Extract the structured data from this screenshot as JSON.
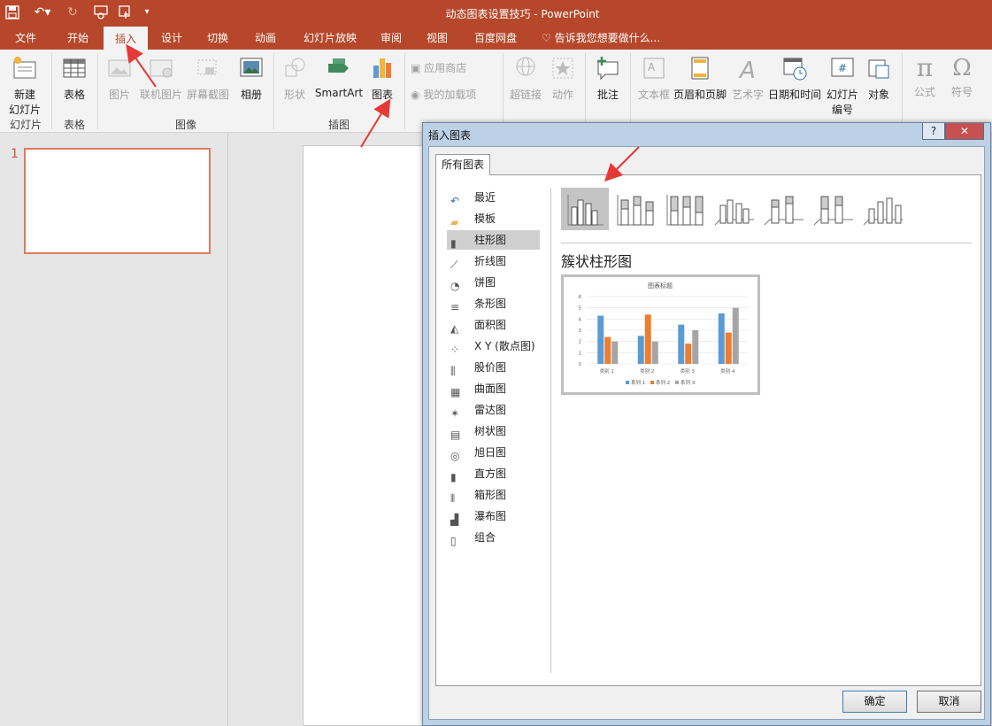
{
  "titlebar": {
    "title": "动态图表设置技巧 - PowerPoint",
    "quick_access": [
      "save-icon",
      "undo-icon",
      "redo-icon",
      "present-icon",
      "touch-mode-icon",
      "customize-icon"
    ]
  },
  "tabs": [
    "文件",
    "开始",
    "插入",
    "设计",
    "切换",
    "动画",
    "幻灯片放映",
    "审阅",
    "视图",
    "百度网盘"
  ],
  "active_tab": "插入",
  "tell_me": "告诉我您想要做什么...",
  "ribbon": {
    "new_slide": "新建\n幻灯片",
    "new_slide_line1": "新建",
    "new_slide_line2": "幻灯片",
    "table": "表格",
    "picture": "图片",
    "online_picture": "联机图片",
    "screenshot": "屏幕截图",
    "album": "相册",
    "shapes": "形状",
    "smartart": "SmartArt",
    "chart": "图表",
    "app_store": "应用商店",
    "my_addins": "我的加载项",
    "hyperlink": "超链接",
    "action": "动作",
    "comment": "批注",
    "textbox": "文本框",
    "header_footer": "页眉和页脚",
    "wordart": "艺术字",
    "datetime": "日期和时间",
    "slide_number_l1": "幻灯片",
    "slide_number_l2": "编号",
    "object": "对象",
    "equation": "公式",
    "symbol": "符号",
    "groups": {
      "slides": "幻灯片",
      "tables": "表格",
      "images": "图像",
      "illustrations": "插图"
    }
  },
  "slides": {
    "number": "1"
  },
  "dialog": {
    "title": "插入图表",
    "help": "?",
    "close": "✕",
    "tab": "所有图表",
    "categories": [
      "最近",
      "模板",
      "柱形图",
      "折线图",
      "饼图",
      "条形图",
      "面积图",
      "X Y (散点图)",
      "股价图",
      "曲面图",
      "雷达图",
      "树状图",
      "旭日图",
      "直方图",
      "箱形图",
      "瀑布图",
      "组合"
    ],
    "selected_category": "柱形图",
    "subtype_title": "簇状柱形图",
    "ok": "确定",
    "cancel": "取消"
  },
  "chart_data": {
    "type": "bar",
    "title": "图表标题",
    "categories": [
      "类别 1",
      "类别 2",
      "类别 3",
      "类别 4"
    ],
    "series": [
      {
        "name": "系列 1",
        "values": [
          4.3,
          2.5,
          3.5,
          4.5
        ],
        "color": "#5b9bd5"
      },
      {
        "name": "系列 2",
        "values": [
          2.4,
          4.4,
          1.8,
          2.8
        ],
        "color": "#ed7d31"
      },
      {
        "name": "系列 3",
        "values": [
          2,
          2,
          3,
          5
        ],
        "color": "#a5a5a5"
      }
    ],
    "yticks": [
      "0",
      "1",
      "2",
      "3",
      "4",
      "5",
      "6"
    ],
    "ylim": [
      0,
      6
    ],
    "legend": "bottom"
  },
  "colors": {
    "accent": "#b7472a",
    "annotation_arrow": "#e53935"
  }
}
